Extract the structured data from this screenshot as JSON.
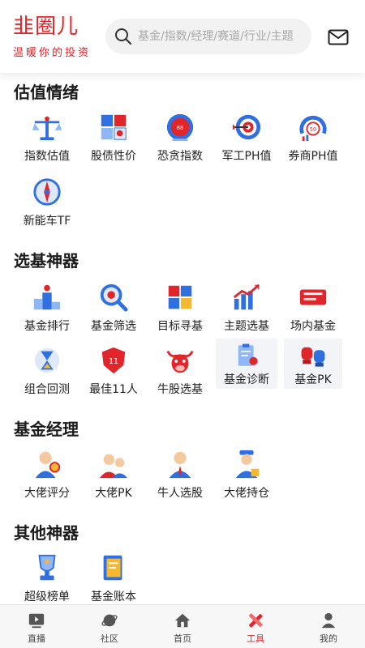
{
  "header": {
    "brand_name": "韭圈儿",
    "brand_slogan": "温暖你的投资",
    "search_placeholder": "基金/指数/经理/赛道/行业/主题"
  },
  "sections": [
    {
      "title": "估值情绪",
      "items": [
        {
          "label": "指数估值",
          "icon": "scale-icon"
        },
        {
          "label": "股债性价",
          "icon": "stock-bond-puzzle-icon"
        },
        {
          "label": "恐贪指数",
          "icon": "gauge-icon"
        },
        {
          "label": "军工PH值",
          "icon": "target-icon"
        },
        {
          "label": "券商PH值",
          "icon": "broker-gauge-icon"
        },
        {
          "label": "新能车TF",
          "icon": "compass-icon"
        }
      ]
    },
    {
      "title": "选基神器",
      "items": [
        {
          "label": "基金排行",
          "icon": "podium-icon"
        },
        {
          "label": "基金筛选",
          "icon": "magnifier-icon"
        },
        {
          "label": "目标寻基",
          "icon": "cubes-icon"
        },
        {
          "label": "主题选基",
          "icon": "bar-chart-icon"
        },
        {
          "label": "场内基金",
          "icon": "discount-ticket-icon"
        },
        {
          "label": "组合回测",
          "icon": "hourglass-icon"
        },
        {
          "label": "最佳11人",
          "icon": "shield-badge-icon"
        },
        {
          "label": "牛股选基",
          "icon": "bull-icon"
        },
        {
          "label": "基金诊断",
          "icon": "clipboard-icon"
        },
        {
          "label": "基金PK",
          "icon": "boxing-gloves-icon"
        }
      ]
    },
    {
      "title": "基金经理",
      "items": [
        {
          "label": "大佬评分",
          "icon": "manager-score-icon"
        },
        {
          "label": "大佬PK",
          "icon": "manager-pk-icon"
        },
        {
          "label": "牛人选股",
          "icon": "manager-pick-icon"
        },
        {
          "label": "大佬持仓",
          "icon": "manager-holding-icon"
        }
      ]
    },
    {
      "title": "其他神器",
      "items": [
        {
          "label": "超级榜单",
          "icon": "trophy-icon"
        },
        {
          "label": "基金账本",
          "icon": "ledger-icon"
        }
      ]
    }
  ],
  "tabs": [
    {
      "label": "直播",
      "icon": "live-tv-icon",
      "active": false
    },
    {
      "label": "社区",
      "icon": "planet-icon",
      "active": false
    },
    {
      "label": "首页",
      "icon": "home-icon",
      "active": false
    },
    {
      "label": "工具",
      "icon": "tools-icon",
      "active": true
    },
    {
      "label": "我的",
      "icon": "user-icon",
      "active": false
    }
  ],
  "colors": {
    "brand": "#e0252b",
    "accent_blue": "#2f6fe0",
    "text": "#222222"
  }
}
